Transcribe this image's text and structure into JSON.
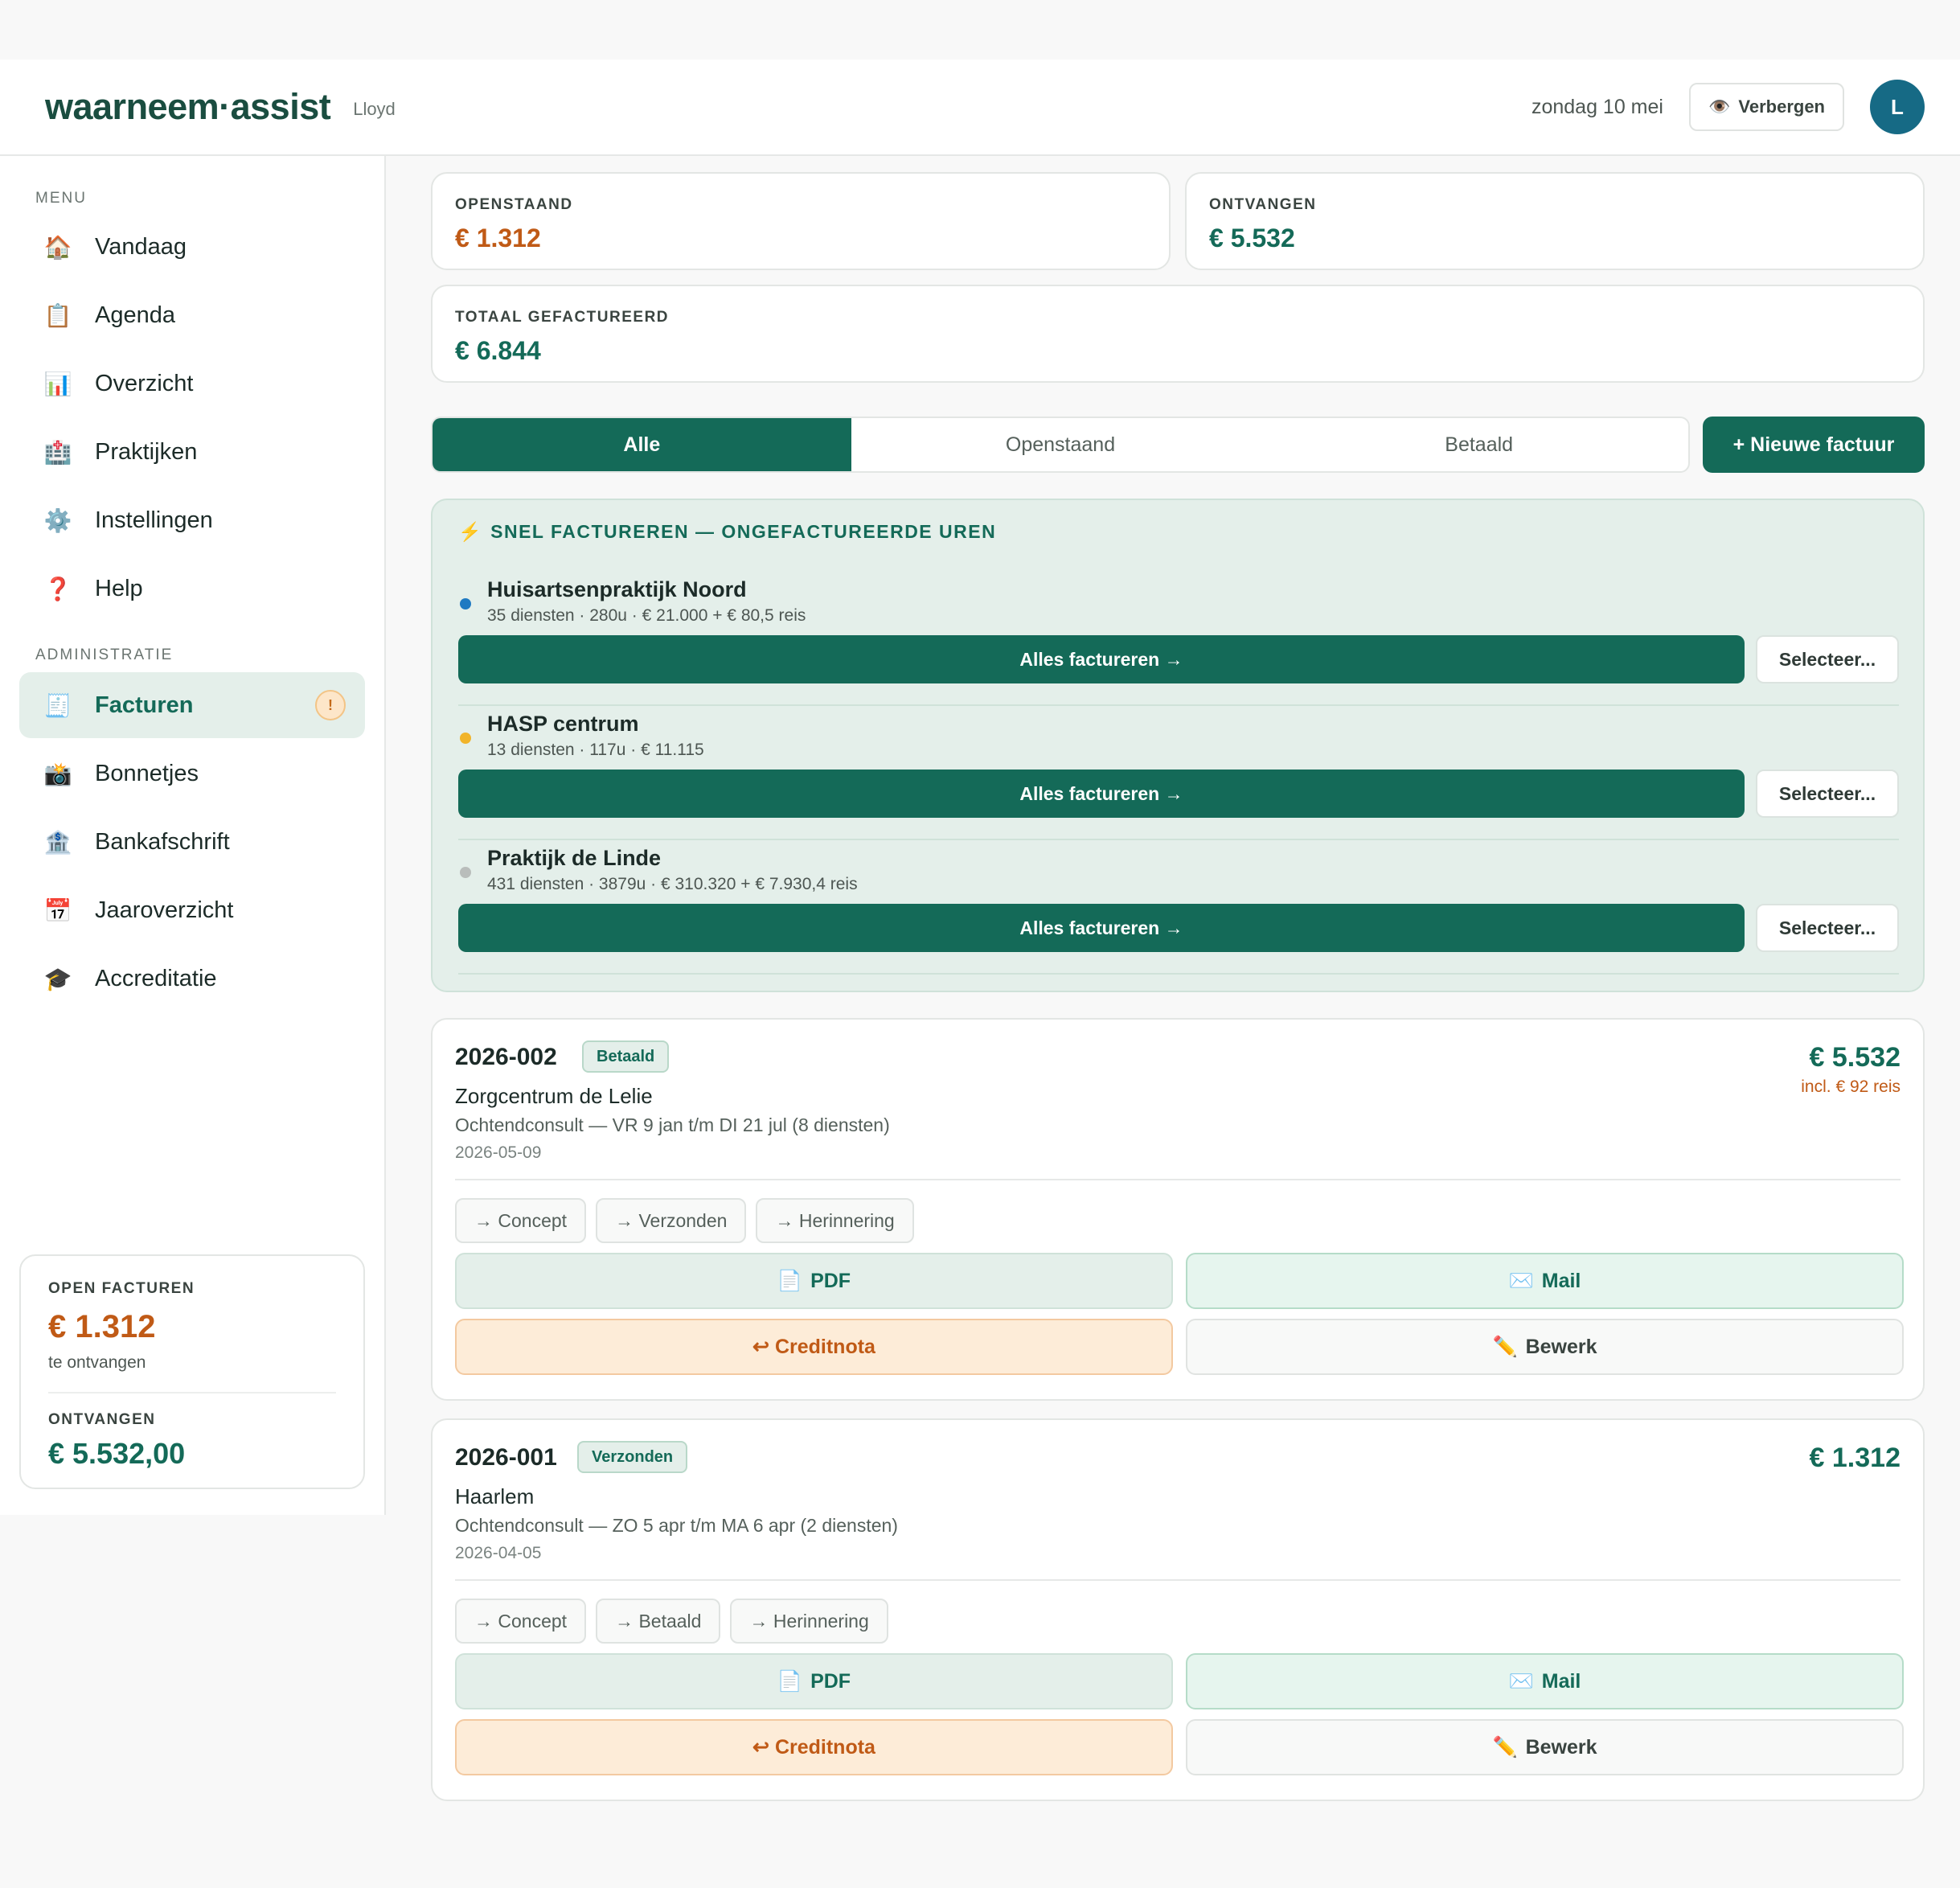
{
  "header": {
    "logo": "waarneem·assist",
    "user": "Lloyd",
    "date": "zondag 10 mei",
    "hide_label": "Verbergen",
    "hide_icon": "eye-icon",
    "avatar_initial": "L"
  },
  "sidebar": {
    "menu_label": "MENU",
    "menu": [
      {
        "label": "Vandaag",
        "icon": "🏠"
      },
      {
        "label": "Agenda",
        "icon": "📋"
      },
      {
        "label": "Overzicht",
        "icon": "📊"
      },
      {
        "label": "Praktijken",
        "icon": "🏥"
      },
      {
        "label": "Instellingen",
        "icon": "⚙️"
      },
      {
        "label": "Help",
        "icon": "❓"
      }
    ],
    "admin_label": "ADMINISTRATIE",
    "admin": [
      {
        "label": "Facturen",
        "icon": "🧾",
        "badge": "!"
      },
      {
        "label": "Bonnetjes",
        "icon": "📸"
      },
      {
        "label": "Bankafschrift",
        "icon": "🏦"
      },
      {
        "label": "Jaaroverzicht",
        "icon": "📅"
      },
      {
        "label": "Accreditatie",
        "icon": "🎓"
      }
    ],
    "summary": {
      "open_label": "OPEN FACTUREN",
      "open_value": "€ 1.312",
      "open_sub": "te ontvangen",
      "received_label": "ONTVANGEN",
      "received_value": "€ 5.532,00"
    }
  },
  "stats": {
    "open_label": "OPENSTAAND",
    "open_value": "€ 1.312",
    "received_label": "ONTVANGEN",
    "received_value": "€ 5.532",
    "total_label": "TOTAAL GEFACTUREERD",
    "total_value": "€ 6.844"
  },
  "filters": {
    "tabs": [
      "Alle",
      "Openstaand",
      "Betaald"
    ],
    "active": "Alle",
    "new_invoice": "+ Nieuwe factuur"
  },
  "quick": {
    "title": "SNEL FACTUREREN — ONGEFACTUREERDE UREN",
    "bolt": "⚡",
    "all_label": "Alles factureren →",
    "select_label": "Selecteer...",
    "rows": [
      {
        "name": "Huisartsenpraktijk Noord",
        "meta": "35 diensten · 280u · € 21.000 + € 80,5 reis",
        "color": "#1f7ac2"
      },
      {
        "name": "HASP centrum",
        "meta": "13 diensten · 117u · € 11.115",
        "color": "#f1b42a"
      },
      {
        "name": "Praktijk de Linde",
        "meta": "431 diensten · 3879u · € 310.320 + € 7.930,4 reis",
        "color": "#b9bdbb"
      }
    ]
  },
  "invoices": [
    {
      "number": "2026-002",
      "status": "Betaald",
      "amount": "€ 5.532",
      "reis": "incl. € 92 reis",
      "client": "Zorgcentrum de Lelie",
      "desc": "Ochtendconsult — VR 9 jan t/m DI 21 jul (8 diensten)",
      "date": "2026-05-09",
      "chips": [
        "→ Concept",
        "→ Verzonden",
        "→ Herinnering"
      ],
      "pdf": "PDF",
      "mail": "Mail",
      "credit": "↩ Creditnota",
      "edit": "Bewerk"
    },
    {
      "number": "2026-001",
      "status": "Verzonden",
      "amount": "€ 1.312",
      "client": "Haarlem",
      "desc": "Ochtendconsult — ZO 5 apr t/m MA 6 apr (2 diensten)",
      "date": "2026-04-05",
      "chips": [
        "→ Concept",
        "→ Betaald",
        "→ Herinnering"
      ],
      "pdf": "PDF",
      "mail": "Mail",
      "credit": "↩ Creditnota",
      "edit": "Bewerk"
    }
  ]
}
